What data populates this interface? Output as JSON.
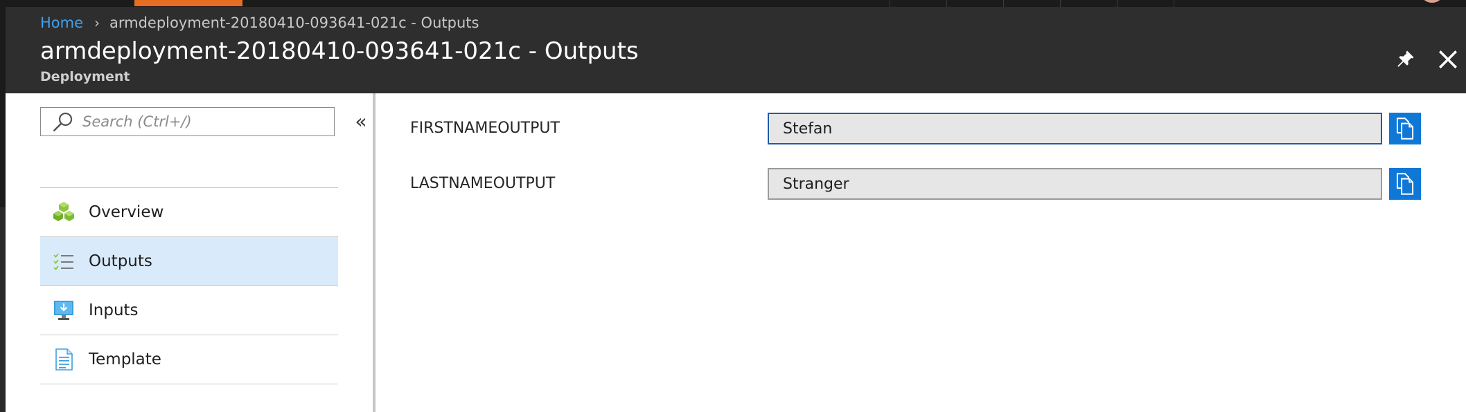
{
  "breadcrumb": {
    "home": "Home",
    "separator": "›",
    "current": "armdeployment-20180410-093641-021c - Outputs"
  },
  "blade": {
    "title": "armdeployment-20180410-093641-021c - Outputs",
    "subtitle": "Deployment",
    "pin_icon": "pin-icon",
    "close_icon": "close-icon"
  },
  "search": {
    "placeholder": "Search (Ctrl+/)",
    "icon": "search-icon"
  },
  "collapse_label": "«",
  "menu": {
    "items": [
      {
        "label": "Overview",
        "icon": "overview-cubes-icon",
        "active": false
      },
      {
        "label": "Outputs",
        "icon": "outputs-list-icon",
        "active": true
      },
      {
        "label": "Inputs",
        "icon": "inputs-monitor-icon",
        "active": false
      },
      {
        "label": "Template",
        "icon": "template-document-icon",
        "active": false
      }
    ]
  },
  "outputs": [
    {
      "name": "FIRSTNAMEOUTPUT",
      "value": "Stefan",
      "copy_icon": "copy-icon"
    },
    {
      "name": "LASTNAMEOUTPUT",
      "value": "Stranger",
      "copy_icon": "copy-icon"
    }
  ],
  "colors": {
    "accent": "#0f78d7",
    "link": "#3ea3f0",
    "active_item": "#d9ebfb",
    "header_bg": "#2e2e2e",
    "top_tab": "#e66e22"
  }
}
